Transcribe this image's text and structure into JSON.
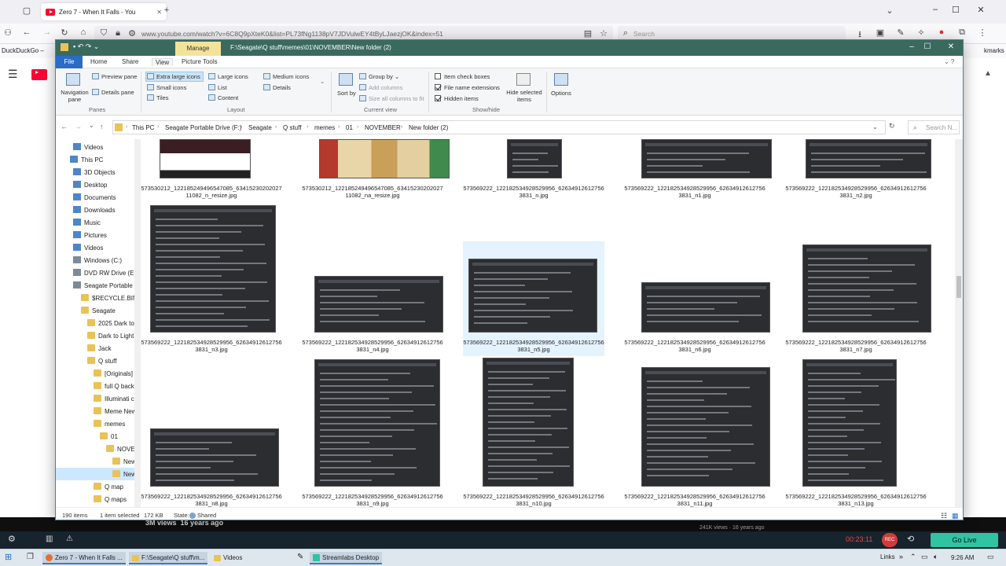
{
  "browser": {
    "tab_title": "Zero 7 - When It Falls - You",
    "new_tab": "+",
    "url": "www.youtube.com/watch?v=6C8Q9pXteK0&list=PL73fNg1138pV7JDVulwEY4tByLJaezjOK&index=51",
    "search_placeholder": "Search",
    "bookmark_left": "DuckDuckGo –",
    "bookmark_right": "kmarks",
    "minimize": "–",
    "maximize": "☐",
    "close": "✕"
  },
  "youtube": {
    "views": "3M views",
    "age": "16 years ago",
    "side_views": "241K views · 16 years ago"
  },
  "explorer": {
    "title_path": "F:\\Seagate\\Q stuff\\memes\\01\\NOVEMBER\\New folder (2)",
    "manage_tab": "Manage",
    "ribbon_tabs": {
      "file": "File",
      "home": "Home",
      "share": "Share",
      "view": "View",
      "picture_tools": "Picture Tools"
    },
    "panes": {
      "navigation_pane": "Navigation pane",
      "preview_pane": "Preview pane",
      "details_pane": "Details pane",
      "group_label": "Panes"
    },
    "layout": {
      "extra_large_icons": "Extra large icons",
      "large_icons": "Large icons",
      "medium_icons": "Medium icons",
      "small_icons": "Small icons",
      "list": "List",
      "details": "Details",
      "tiles": "Tiles",
      "content": "Content",
      "group_label": "Layout"
    },
    "current_view": {
      "sort_by": "Sort by",
      "group_by": "Group by",
      "add_columns": "Add columns",
      "size_all_columns": "Size all columns to fit",
      "group_label": "Current view"
    },
    "show_hide": {
      "item_check_boxes": "Item check boxes",
      "file_name_extensions": "File name extensions",
      "hidden_items": "Hidden items",
      "hide_selected": "Hide selected items",
      "options": "Options",
      "group_label": "Show/hide"
    },
    "breadcrumbs": [
      "This PC",
      "Seagate Portable Drive (F:)",
      "Seagate",
      "Q stuff",
      "memes",
      "01",
      "NOVEMBER",
      "New folder (2)"
    ],
    "search_placeholder": "Search N...",
    "nav_items": [
      {
        "label": "Videos",
        "icon": "videos-icon"
      },
      {
        "label": "This PC",
        "icon": "pc-icon"
      },
      {
        "label": "3D Objects",
        "icon": "objects-icon"
      },
      {
        "label": "Desktop",
        "icon": "desktop-icon"
      },
      {
        "label": "Documents",
        "icon": "documents-icon"
      },
      {
        "label": "Downloads",
        "icon": "downloads-icon"
      },
      {
        "label": "Music",
        "icon": "music-icon"
      },
      {
        "label": "Pictures",
        "icon": "pictures-icon"
      },
      {
        "label": "Videos",
        "icon": "videos-icon"
      },
      {
        "label": "Windows (C:)",
        "icon": "drive-icon"
      },
      {
        "label": "DVD RW Drive (E",
        "icon": "dvd-icon"
      },
      {
        "label": "Seagate Portable",
        "icon": "drive-icon"
      },
      {
        "label": "$RECYCLE.BIN",
        "icon": "folder-icon"
      },
      {
        "label": "Seagate",
        "icon": "folder-icon"
      },
      {
        "label": "2025 Dark to",
        "icon": "folder-icon"
      },
      {
        "label": "Dark to Light",
        "icon": "folder-icon"
      },
      {
        "label": "Jack",
        "icon": "folder-icon"
      },
      {
        "label": "Q stuff",
        "icon": "folder-icon"
      },
      {
        "label": "[Originals]",
        "icon": "folder-icon"
      },
      {
        "label": "full Q back",
        "icon": "folder-icon"
      },
      {
        "label": "Illuminati c",
        "icon": "folder-icon"
      },
      {
        "label": "Meme New",
        "icon": "folder-icon"
      },
      {
        "label": "memes",
        "icon": "folder-icon"
      },
      {
        "label": "01",
        "icon": "folder-icon"
      },
      {
        "label": "NOVEMB",
        "icon": "folder-icon"
      },
      {
        "label": "New fo",
        "icon": "folder-icon"
      },
      {
        "label": "New fo",
        "icon": "folder-icon"
      },
      {
        "label": "Q map",
        "icon": "folder-icon"
      },
      {
        "label": "Q maps",
        "icon": "folder-icon"
      }
    ],
    "files": [
      {
        "line1": "573530212_12218524949654708​5_63415230202027",
        "line2": "11082_n_resize.jpg",
        "kind": "photo"
      },
      {
        "line1": "573530212_12218524949654708​5_63415230202027",
        "line2": "11082_na_resize.jpg",
        "kind": "painting"
      },
      {
        "line1": "573569222_122182534928529956_62634912612756",
        "line2": "3831_n.jpg",
        "kind": "post"
      },
      {
        "line1": "573569222_122182534928529956_62634912612756",
        "line2": "3831_n1.jpg",
        "kind": "post"
      },
      {
        "line1": "573569222_122182534928529956_62634912612756",
        "line2": "3831_n2.jpg",
        "kind": "post"
      },
      {
        "line1": "573569222_122182534928529956_62634912612756",
        "line2": "3831_n3.jpg",
        "kind": "post"
      },
      {
        "line1": "573569222_122182534928529956_62634912612756",
        "line2": "3831_n4.jpg",
        "kind": "post"
      },
      {
        "line1": "573569222_122182534928529956_62634912612756",
        "line2": "3831_n5.jpg",
        "kind": "post"
      },
      {
        "line1": "573569222_122182534928529956_62634912612756",
        "line2": "3831_n6.jpg",
        "kind": "post"
      },
      {
        "line1": "573569222_122182534928529956_62634912612756",
        "line2": "3831_n7.jpg",
        "kind": "post"
      },
      {
        "line1": "573569222_122182534928529956_62634912612756",
        "line2": "3831_n8.jpg",
        "kind": "post"
      },
      {
        "line1": "573569222_122182534928529956_62634912612756",
        "line2": "3831_n9.jpg",
        "kind": "post"
      },
      {
        "line1": "573569222_122182534928529956_62634912612756",
        "line2": "3831_n10.jpg",
        "kind": "post"
      },
      {
        "line1": "573569222_122182534928529956_62634912612756",
        "line2": "3831_n11.jpg",
        "kind": "post"
      },
      {
        "line1": "573569222_122182534928529956_62634912612756",
        "line2": "3831_n13.jpg",
        "kind": "post"
      }
    ],
    "status": {
      "item_count": "190 items",
      "selected": "1 item selected",
      "size": "172 KB",
      "state_label": "State:",
      "state_value": "Shared"
    }
  },
  "streamlabs": {
    "timer": "00:23:11",
    "rec": "REC",
    "go_live": "Go Live"
  },
  "taskbar": {
    "items": [
      "Zero 7 - When It Falls ...",
      "F:\\Seagate\\Q stuff\\m...",
      "Videos",
      "Streamlabs Desktop"
    ],
    "links": "Links",
    "time": "9:26 AM"
  },
  "colors": {
    "explorer_titlebar": "#3a6a5e",
    "manage_tab": "#f3e39a",
    "file_tab": "#2a6cc6",
    "selection": "#cce8ff",
    "go_live": "#31c3a2"
  }
}
